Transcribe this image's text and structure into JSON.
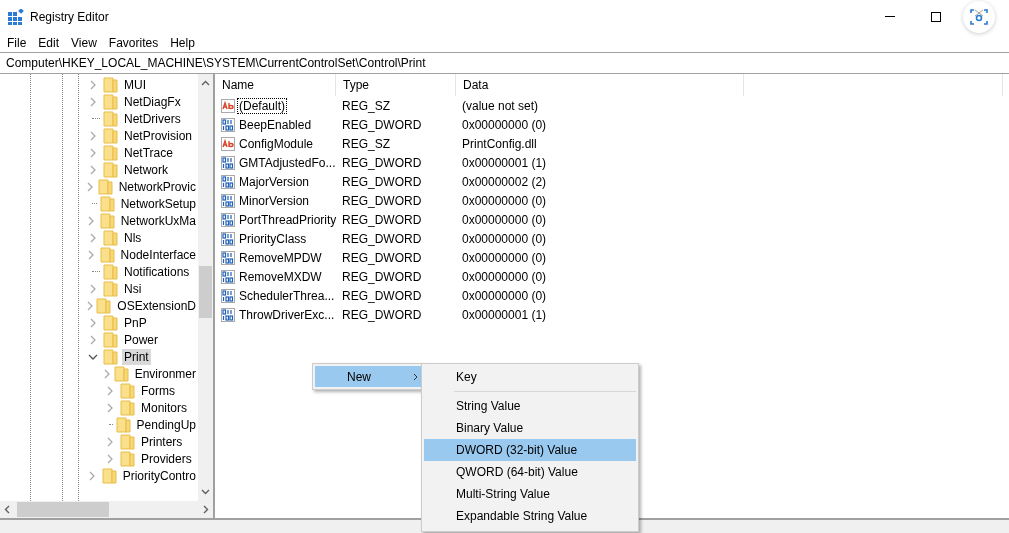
{
  "window": {
    "title": "Registry Editor"
  },
  "menu": [
    "File",
    "Edit",
    "View",
    "Favorites",
    "Help"
  ],
  "address": "Computer\\HKEY_LOCAL_MACHINE\\SYSTEM\\CurrentControlSet\\Control\\Print",
  "tree": [
    {
      "label": "MUI",
      "kind": "branch",
      "selected": false
    },
    {
      "label": "NetDiagFx",
      "kind": "branch",
      "selected": false
    },
    {
      "label": "NetDrivers",
      "kind": "leaf",
      "selected": false
    },
    {
      "label": "NetProvision",
      "kind": "branch",
      "selected": false
    },
    {
      "label": "NetTrace",
      "kind": "branch",
      "selected": false
    },
    {
      "label": "Network",
      "kind": "branch",
      "selected": false
    },
    {
      "label": "NetworkProvic",
      "kind": "branch",
      "selected": false
    },
    {
      "label": "NetworkSetup",
      "kind": "leaf",
      "selected": false
    },
    {
      "label": "NetworkUxMa",
      "kind": "branch",
      "selected": false
    },
    {
      "label": "Nls",
      "kind": "branch",
      "selected": false
    },
    {
      "label": "NodeInterface",
      "kind": "branch",
      "selected": false
    },
    {
      "label": "Notifications",
      "kind": "leaf",
      "selected": false
    },
    {
      "label": "Nsi",
      "kind": "branch",
      "selected": false
    },
    {
      "label": "OSExtensionD",
      "kind": "branch",
      "selected": false
    },
    {
      "label": "PnP",
      "kind": "branch",
      "selected": false
    },
    {
      "label": "Power",
      "kind": "branch",
      "selected": false
    },
    {
      "label": "Print",
      "kind": "branch",
      "expanded": true,
      "selected": true,
      "children": [
        {
          "label": "Environmer",
          "kind": "branch",
          "selected": false
        },
        {
          "label": "Forms",
          "kind": "branch",
          "selected": false
        },
        {
          "label": "Monitors",
          "kind": "branch",
          "selected": false
        },
        {
          "label": "PendingUp",
          "kind": "leaf",
          "selected": false
        },
        {
          "label": "Printers",
          "kind": "branch",
          "selected": false
        },
        {
          "label": "Providers",
          "kind": "branch",
          "selected": false
        }
      ]
    },
    {
      "label": "PriorityContro",
      "kind": "branch",
      "selected": false
    }
  ],
  "table": {
    "columns": [
      "Name",
      "Type",
      "Data"
    ],
    "rows": [
      {
        "kind": "string",
        "name": "(Default)",
        "type": "REG_SZ",
        "data": "(value not set)",
        "focused": true
      },
      {
        "kind": "dword",
        "name": "BeepEnabled",
        "type": "REG_DWORD",
        "data": "0x00000000 (0)",
        "focused": false
      },
      {
        "kind": "string",
        "name": "ConfigModule",
        "type": "REG_SZ",
        "data": "PrintConfig.dll",
        "focused": false
      },
      {
        "kind": "dword",
        "name": "GMTAdjustedFo...",
        "type": "REG_DWORD",
        "data": "0x00000001 (1)",
        "focused": false
      },
      {
        "kind": "dword",
        "name": "MajorVersion",
        "type": "REG_DWORD",
        "data": "0x00000002 (2)",
        "focused": false
      },
      {
        "kind": "dword",
        "name": "MinorVersion",
        "type": "REG_DWORD",
        "data": "0x00000000 (0)",
        "focused": false
      },
      {
        "kind": "dword",
        "name": "PortThreadPriority",
        "type": "REG_DWORD",
        "data": "0x00000000 (0)",
        "focused": false
      },
      {
        "kind": "dword",
        "name": "PriorityClass",
        "type": "REG_DWORD",
        "data": "0x00000000 (0)",
        "focused": false
      },
      {
        "kind": "dword",
        "name": "RemoveMPDW",
        "type": "REG_DWORD",
        "data": "0x00000000 (0)",
        "focused": false
      },
      {
        "kind": "dword",
        "name": "RemoveMXDW",
        "type": "REG_DWORD",
        "data": "0x00000000 (0)",
        "focused": false
      },
      {
        "kind": "dword",
        "name": "SchedulerThrea...",
        "type": "REG_DWORD",
        "data": "0x00000000 (0)",
        "focused": false
      },
      {
        "kind": "dword",
        "name": "ThrowDriverExc...",
        "type": "REG_DWORD",
        "data": "0x00000001 (1)",
        "focused": false
      }
    ]
  },
  "context_menu": {
    "items": [
      {
        "label": "New",
        "selected": true
      }
    ]
  },
  "submenu": {
    "items": [
      {
        "kind": "item",
        "label": "Key",
        "selected": false
      },
      {
        "kind": "separator"
      },
      {
        "kind": "item",
        "label": "String Value",
        "selected": false
      },
      {
        "kind": "item",
        "label": "Binary Value",
        "selected": false
      },
      {
        "kind": "item",
        "label": "DWORD (32-bit) Value",
        "selected": true
      },
      {
        "kind": "item",
        "label": "QWORD (64-bit) Value",
        "selected": false
      },
      {
        "kind": "item",
        "label": "Multi-String Value",
        "selected": false
      },
      {
        "kind": "item",
        "label": "Expandable String Value",
        "selected": false
      }
    ]
  }
}
